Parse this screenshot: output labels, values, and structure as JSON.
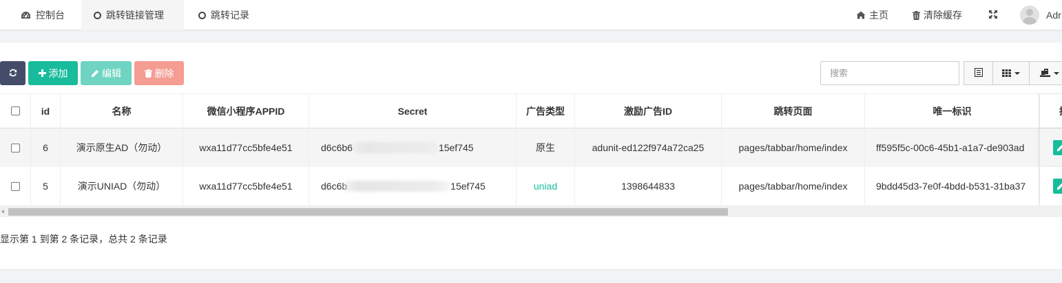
{
  "topnav": {
    "tabs": [
      {
        "label": "控制台",
        "icon": "dashboard-icon"
      },
      {
        "label": "跳转链接管理",
        "icon": "circle-icon",
        "active": true
      },
      {
        "label": "跳转记录",
        "icon": "circle-icon"
      }
    ],
    "right": {
      "home_label": "主页",
      "clear_cache_label": "清除缓存",
      "user_name": "Adr"
    }
  },
  "toolbar": {
    "add_label": "添加",
    "edit_label": "编辑",
    "delete_label": "删除",
    "search_placeholder": "搜索"
  },
  "table": {
    "columns": [
      "id",
      "名称",
      "微信小程序APPID",
      "Secret",
      "广告类型",
      "激励广告ID",
      "跳转页面",
      "唯一标识",
      "操"
    ],
    "rows": [
      {
        "id": "6",
        "name": "演示原生AD（勿动）",
        "appid": "wxa11d77cc5bfe4e51",
        "secret_prefix": "d6c6b6",
        "secret_suffix": "15ef745",
        "ad_type": "原生",
        "ad_id": "adunit-ed122f974a72ca25",
        "page": "pages/tabbar/home/index",
        "uid": "ff595f5c-00c6-45b1-a1a7-de903ad"
      },
      {
        "id": "5",
        "name": "演示UNIAD（勿动）",
        "appid": "wxa11d77cc5bfe4e51",
        "secret_prefix": "d6c6b",
        "secret_suffix": "15ef745",
        "ad_type": "uniad",
        "ad_id": "1398644833",
        "page": "pages/tabbar/home/index",
        "uid": "9bdd45d3-7e0f-4bdd-b531-31ba37"
      }
    ]
  },
  "pagination": {
    "info": "显示第 1 到第 2 条记录，总共 2 条记录"
  },
  "colors": {
    "primary": "#18bc9c",
    "dark": "#444c69",
    "danger_light": "#f59c93",
    "success_light": "#6fd4c1"
  }
}
